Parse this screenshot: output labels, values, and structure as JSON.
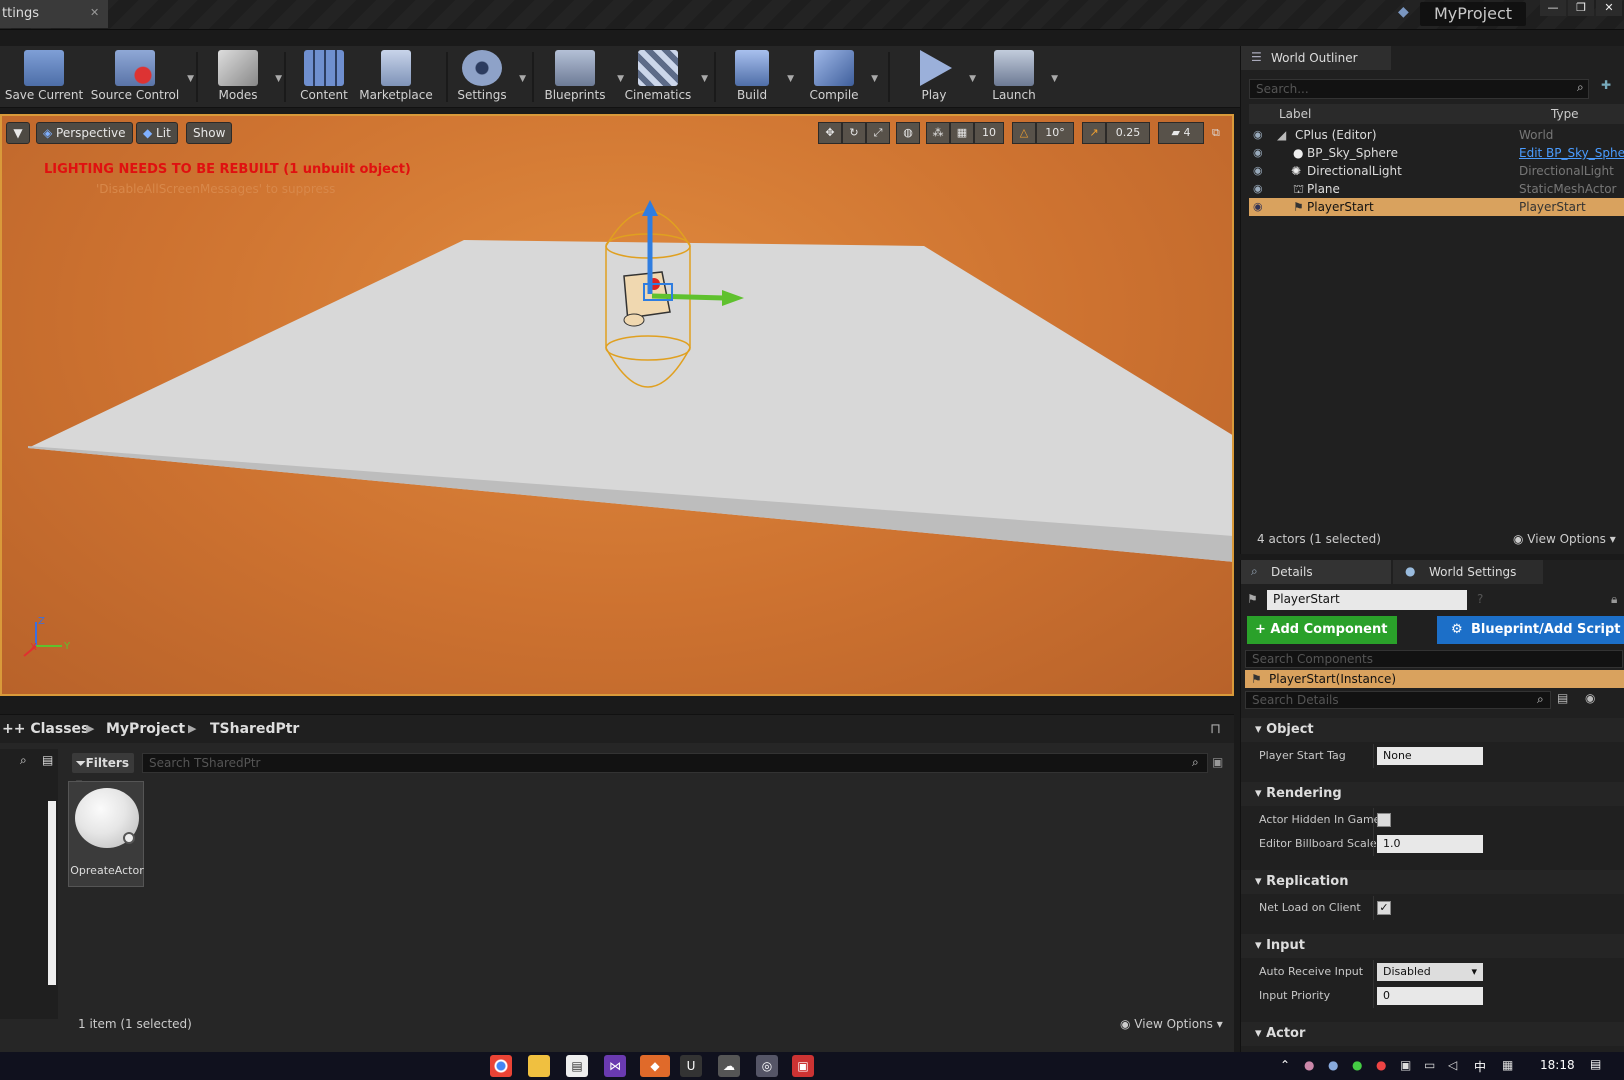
{
  "window": {
    "tab_label": "ttings",
    "project_name": "MyProject",
    "controls": [
      "—",
      "❐",
      "✕"
    ]
  },
  "toolbar": {
    "buttons": [
      {
        "label": "Save Current",
        "color": "#7f9fd6"
      },
      {
        "label": "Source Control",
        "color": "#8fa8d6"
      },
      {
        "label": "Modes",
        "color": "#d0d0d0"
      },
      {
        "label": "Content",
        "color": "#6f8fcf"
      },
      {
        "label": "Marketplace",
        "color": "#a6b8d8"
      },
      {
        "label": "Settings",
        "color": "#8ea2c8"
      },
      {
        "label": "Blueprints",
        "color": "#9aa8c0"
      },
      {
        "label": "Cinematics",
        "color": "#9aa8c0"
      },
      {
        "label": "Build",
        "color": "#8aa6da"
      },
      {
        "label": "Compile",
        "color": "#8aa6da"
      },
      {
        "label": "Play",
        "color": "#9bb0da"
      },
      {
        "label": "Launch",
        "color": "#a8b4c8"
      }
    ]
  },
  "viewport": {
    "view_mode": "Perspective",
    "lit_mode": "Lit",
    "show": "Show",
    "grid_snap": "10",
    "rot_snap": "10°",
    "scale_snap": "0.25",
    "camera_speed": "4",
    "lighting_warning": "LIGHTING NEEDS TO BE REBUILT (1 unbuilt object)",
    "suppress_hint": "'DisableAllScreenMessages' to suppress"
  },
  "outliner": {
    "tab": "World Outliner",
    "search_placeholder": "Search...",
    "col_label": "Label",
    "col_type": "Type",
    "rows": [
      {
        "label": "CPlus (Editor)",
        "type": "World"
      },
      {
        "label": "BP_Sky_Sphere",
        "type": "Edit BP_Sky_Sphe"
      },
      {
        "label": "DirectionalLight",
        "type": "DirectionalLight"
      },
      {
        "label": "Plane",
        "type": "StaticMeshActor"
      },
      {
        "label": "PlayerStart",
        "type": "PlayerStart"
      }
    ],
    "status": "4 actors (1 selected)",
    "view_options": "View Options"
  },
  "details": {
    "tab_details": "Details",
    "tab_world_settings": "World Settings",
    "actor_name": "PlayerStart",
    "add_component": "+ Add Component",
    "blueprint_script": "Blueprint/Add Script",
    "search_components": "Search Components",
    "instance_row": "PlayerStart(Instance)",
    "search_details": "Search Details",
    "categories": {
      "object": "Object",
      "rendering": "Rendering",
      "replication": "Replication",
      "input": "Input",
      "actor": "Actor"
    },
    "props": {
      "player_start_tag": {
        "label": "Player Start Tag",
        "value": "None"
      },
      "actor_hidden": {
        "label": "Actor Hidden In Game"
      },
      "billboard_scale": {
        "label": "Editor Billboard Scale",
        "value": "1.0"
      },
      "net_load": {
        "label": "Net Load on Client",
        "check": "✓"
      },
      "auto_receive": {
        "label": "Auto Receive Input",
        "value": "Disabled"
      },
      "input_priority": {
        "label": "Input Priority",
        "value": "0"
      }
    }
  },
  "content_browser": {
    "breadcrumbs": [
      "++ Classes",
      "MyProject",
      "TSharedPtr"
    ],
    "filters": "Filters",
    "search_placeholder": "Search TSharedPtr",
    "asset_name": "OpreateActor",
    "status": "1 item (1 selected)",
    "view_options": "View Options"
  },
  "taskbar": {
    "clock": "18:18",
    "tray_ime": "中"
  }
}
